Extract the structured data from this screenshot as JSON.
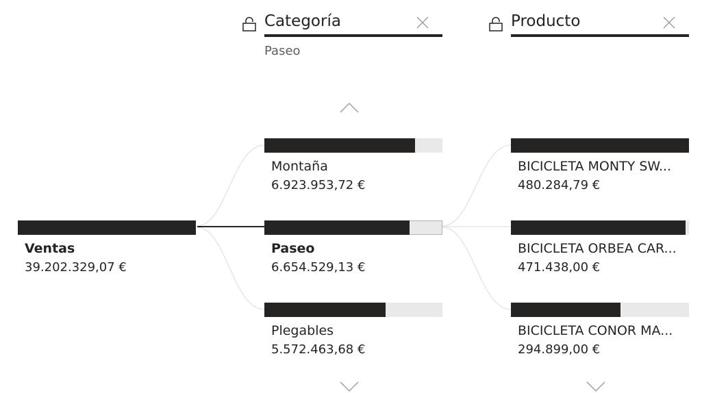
{
  "columns": [
    {
      "title": "Categoría",
      "selected_label": "Paseo"
    },
    {
      "title": "Producto"
    }
  ],
  "root": {
    "label": "Ventas",
    "value": "39.202.329,07 €",
    "fill": 1.0
  },
  "categoria_nodes": [
    {
      "label": "Montaña",
      "value": "6.923.953,72 €",
      "fill": 0.848
    },
    {
      "label": "Paseo",
      "value": "6.654.529,13 €",
      "fill": 0.815
    },
    {
      "label": "Plegables",
      "value": "5.572.463,68 €",
      "fill": 0.682
    }
  ],
  "producto_nodes": [
    {
      "label": "BICICLETA MONTY SW...",
      "value": "480.284,79 €",
      "fill": 1.0
    },
    {
      "label": "BICICLETA ORBEA CAR...",
      "value": "471.438,00 €",
      "fill": 0.982
    },
    {
      "label": "BICICLETA CONOR MA...",
      "value": "294.899,00 €",
      "fill": 0.614
    }
  ],
  "icons": {
    "lock": "lock-icon",
    "close": "close-icon",
    "scroll_up": "chevron-up-icon",
    "scroll_down": "chevron-down-icon"
  },
  "colors": {
    "bar": "#252423",
    "track": "#e9e9e9",
    "link": "#e6e6e6",
    "active_link": "#252423"
  }
}
